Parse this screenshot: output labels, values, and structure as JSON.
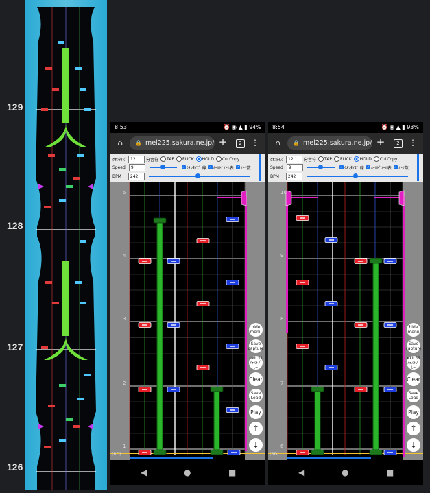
{
  "left_column": {
    "measure_labels": [
      "129",
      "128",
      "127",
      "126"
    ]
  },
  "phones": [
    {
      "time": "8:53",
      "battery": "94%",
      "url": "mel225.sakura.ne.jp/uns",
      "tab_count": "2",
      "quantize_label": "ｸｵﾝﾀｲｽﾞ",
      "quantize_value": "12",
      "quantize_unit": "分音符",
      "speed_label": "Speed",
      "speed_value": "9",
      "bpm_label": "BPM",
      "bpm_value": "242",
      "radio_tap": "TAP",
      "radio_flick": "FLICK",
      "radio_hold": "HOLD",
      "radio_cutcopy": "CutCopy",
      "check_quantize_line": "ｸｵﾝﾀｲｽﾞ 線",
      "check_hold_obj": "ﾎｰﾙﾄﾞﾉｰﾑ表",
      "check_note_num": "ﾉｰﾂ数",
      "measures": [
        "5",
        "4",
        "3",
        "2",
        "1"
      ],
      "footer_label": "(BD)",
      "side_buttons": {
        "hide_menu": "hide menu",
        "save_capture": "Save capture",
        "exit_test": "exit ｸﾘｱﾃｽﾄﾌﾟﾚｰ",
        "clear": "Clear",
        "save_load": "Save Load",
        "play": "Play",
        "up": "↑",
        "down": "↓"
      }
    },
    {
      "time": "8:54",
      "battery": "93%",
      "url": "mel225.sakura.ne.jp/uns",
      "tab_count": "2",
      "quantize_label": "ｸｵﾝﾀｲｽﾞ",
      "quantize_value": "12",
      "quantize_unit": "分音符",
      "speed_label": "Speed",
      "speed_value": "9",
      "bpm_label": "BPM",
      "bpm_value": "242",
      "radio_tap": "TAP",
      "radio_flick": "FLICK",
      "radio_hold": "HOLD",
      "radio_cutcopy": "CutCopy",
      "check_quantize_line": "ｸｵﾝﾀｲｽﾞ 線",
      "check_hold_obj": "ﾎｰﾙﾄﾞﾉｰﾑ表",
      "check_note_num": "ﾉｰﾂ数",
      "measures": [
        "10",
        "9",
        "8",
        "7",
        "6"
      ],
      "footer_label": "(BD)",
      "side_buttons": {
        "hide_menu": "hide menu",
        "save_capture": "Save capture",
        "exit_test": "exit ｸﾘｱﾃｽﾄﾌﾟﾚｰ",
        "clear": "Clear",
        "save_load": "Save Load",
        "play": "Play",
        "up": "↑",
        "down": "↓"
      }
    }
  ],
  "colors": {
    "accent": "#1a73e8",
    "tap_red": "#e8202a",
    "tap_blue": "#1f3fe0",
    "hold_green": "#2bb52b",
    "slide_magenta": "#e020c0",
    "judge_line": "#f2c230"
  }
}
